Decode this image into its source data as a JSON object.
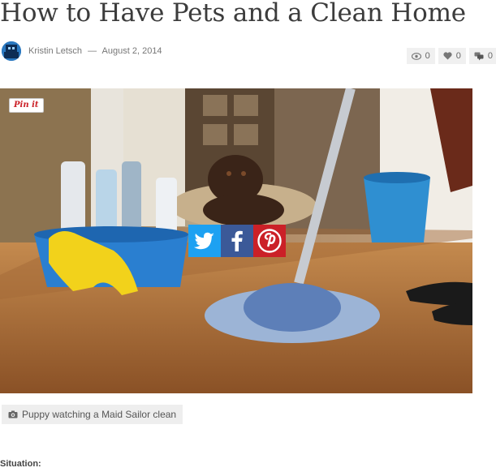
{
  "article": {
    "title": "How to Have Pets and a Clean Home",
    "author": "Kristin Letsch",
    "separator": "—",
    "date": "August 2, 2014"
  },
  "counters": {
    "views": "0",
    "likes": "0",
    "comments": "0"
  },
  "image": {
    "pin_label": "Pin it",
    "caption": "Puppy watching a Maid Sailor clean"
  },
  "share": {
    "icons": [
      "twitter-icon",
      "facebook-icon",
      "pinterest-icon"
    ],
    "colors": {
      "twitter": "#1da1f2",
      "facebook": "#3b5998",
      "pinterest": "#cb2027"
    }
  },
  "body": {
    "section_heading": "Situation:"
  }
}
